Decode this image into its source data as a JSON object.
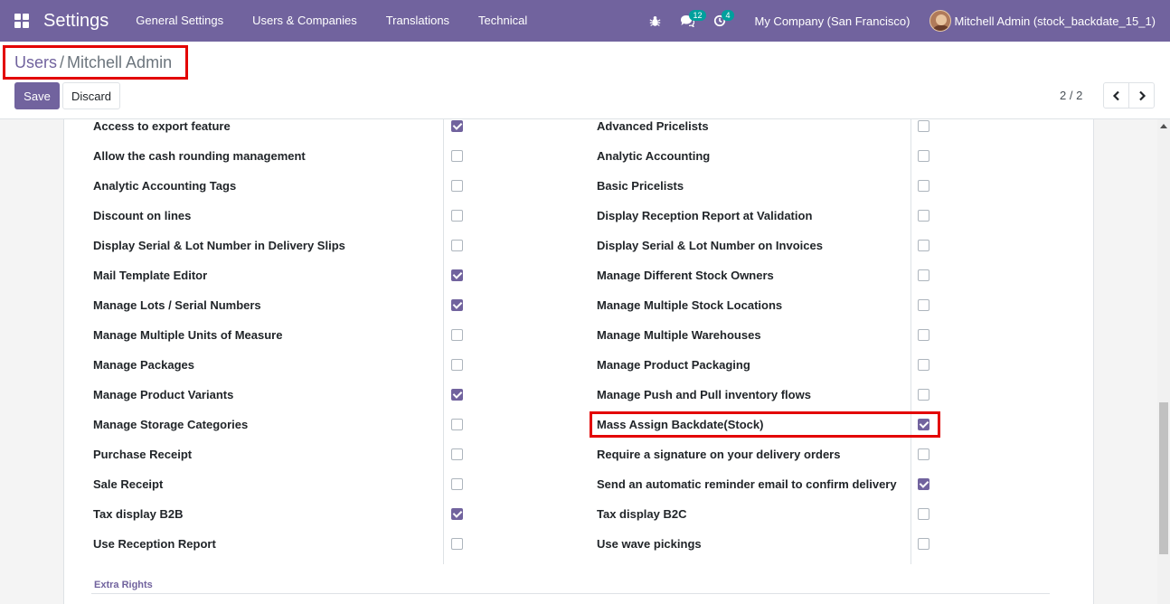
{
  "navbar": {
    "app_title": "Settings",
    "menu": [
      "General Settings",
      "Users & Companies",
      "Translations",
      "Technical"
    ],
    "messages_badge": "12",
    "activity_badge": "4",
    "company": "My Company (San Francisco)",
    "user": "Mitchell Admin (stock_backdate_15_1)",
    "color": "#71639e"
  },
  "breadcrumb": {
    "parent": "Users",
    "separator": "/",
    "current": "Mitchell Admin"
  },
  "actions": {
    "save_label": "Save",
    "discard_label": "Discard"
  },
  "pager": {
    "value": "2 / 2"
  },
  "rights": {
    "left": [
      {
        "label": "Access to export feature",
        "checked": true
      },
      {
        "label": "Allow the cash rounding management",
        "checked": false
      },
      {
        "label": "Analytic Accounting Tags",
        "checked": false
      },
      {
        "label": "Discount on lines",
        "checked": false
      },
      {
        "label": "Display Serial & Lot Number in Delivery Slips",
        "checked": false
      },
      {
        "label": "Mail Template Editor",
        "checked": true
      },
      {
        "label": "Manage Lots / Serial Numbers",
        "checked": true
      },
      {
        "label": "Manage Multiple Units of Measure",
        "checked": false
      },
      {
        "label": "Manage Packages",
        "checked": false
      },
      {
        "label": "Manage Product Variants",
        "checked": true
      },
      {
        "label": "Manage Storage Categories",
        "checked": false
      },
      {
        "label": "Purchase Receipt",
        "checked": false
      },
      {
        "label": "Sale Receipt",
        "checked": false
      },
      {
        "label": "Tax display B2B",
        "checked": true
      },
      {
        "label": "Use Reception Report",
        "checked": false
      }
    ],
    "right": [
      {
        "label": "Advanced Pricelists",
        "checked": false
      },
      {
        "label": "Analytic Accounting",
        "checked": false
      },
      {
        "label": "Basic Pricelists",
        "checked": false
      },
      {
        "label": "Display Reception Report at Validation",
        "checked": false
      },
      {
        "label": "Display Serial & Lot Number on Invoices",
        "checked": false
      },
      {
        "label": "Manage Different Stock Owners",
        "checked": false
      },
      {
        "label": "Manage Multiple Stock Locations",
        "checked": false
      },
      {
        "label": "Manage Multiple Warehouses",
        "checked": false
      },
      {
        "label": "Manage Product Packaging",
        "checked": false
      },
      {
        "label": "Manage Push and Pull inventory flows",
        "checked": false
      },
      {
        "label": "Mass Assign Backdate(Stock)",
        "checked": true
      },
      {
        "label": "Require a signature on your delivery orders",
        "checked": false
      },
      {
        "label": "Send an automatic reminder email to confirm delivery",
        "checked": true
      },
      {
        "label": "Tax display B2C",
        "checked": false
      },
      {
        "label": "Use wave pickings",
        "checked": false
      }
    ]
  },
  "extra_rights_title": "Extra Rights"
}
